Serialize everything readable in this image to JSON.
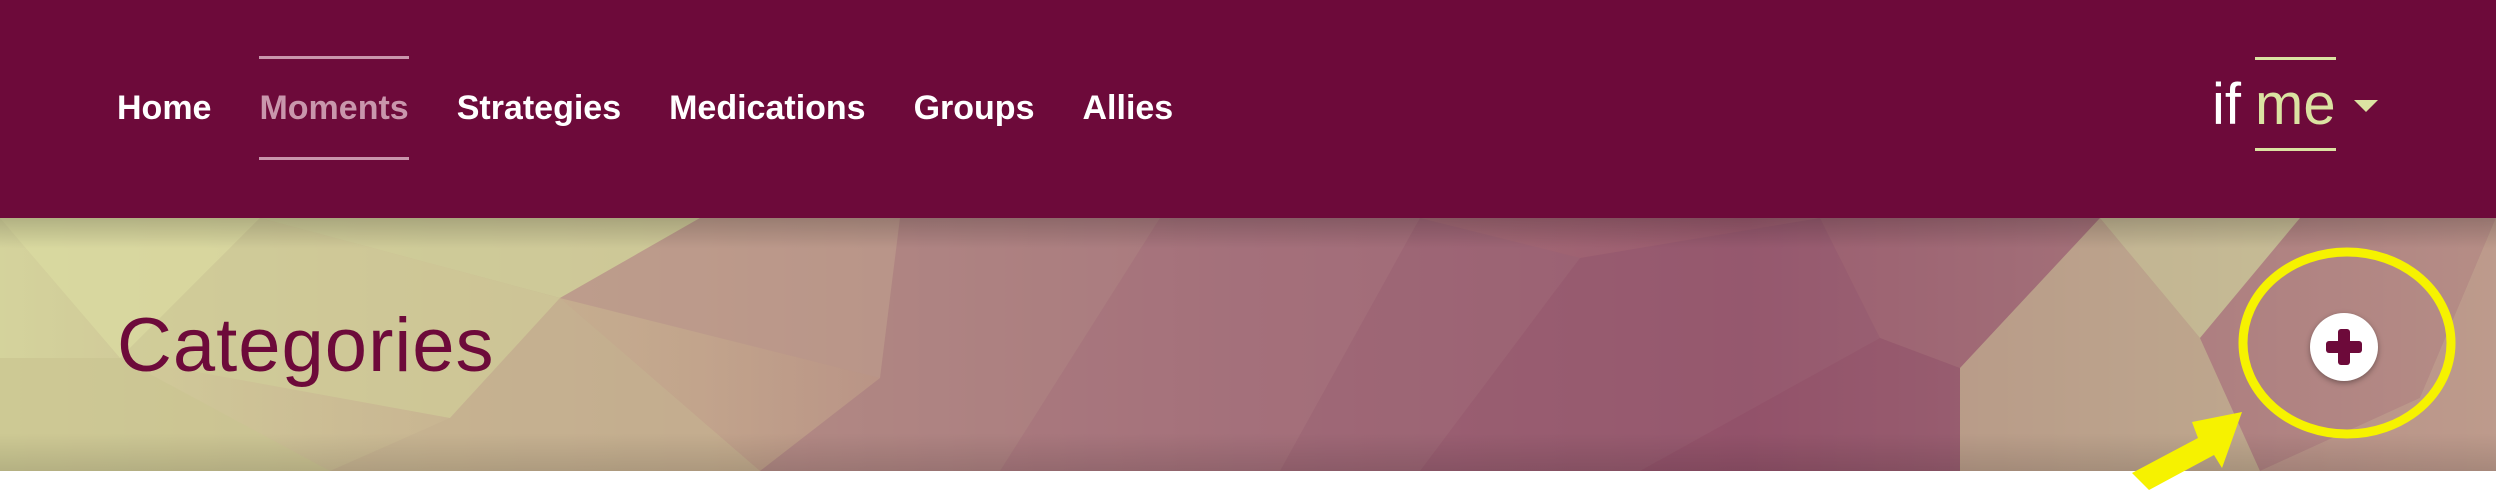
{
  "nav": {
    "items": [
      {
        "label": "Home",
        "active": false
      },
      {
        "label": "Moments",
        "active": true
      },
      {
        "label": "Strategies",
        "active": false
      },
      {
        "label": "Medications",
        "active": false
      },
      {
        "label": "Groups",
        "active": false
      },
      {
        "label": "Allies",
        "active": false
      }
    ]
  },
  "brand": {
    "part1": "if",
    "part2": "me",
    "menu_icon": "caret-down-icon"
  },
  "banner": {
    "title": "Categories",
    "add_icon": "plus-circle-icon"
  },
  "annotation": {
    "highlight_shape": "ellipse",
    "pointer_icon": "arrow-icon",
    "color": "#f6f200"
  },
  "colors": {
    "header_bg": "#6d0a3a",
    "nav_text": "#ffffff",
    "nav_active": "#c996ac",
    "brand_accent": "#dbe3a2",
    "title_color": "#6d0a3a"
  }
}
